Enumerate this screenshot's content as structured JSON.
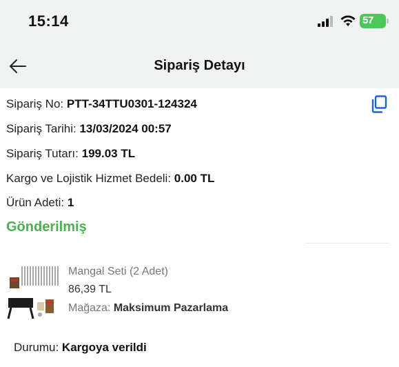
{
  "status_bar": {
    "time": "15:14",
    "battery_level": "57",
    "battery_color": "#4cc85a",
    "icons": [
      "signal-icon",
      "wifi-icon",
      "battery-icon"
    ]
  },
  "header": {
    "title": "Sipariş Detayı",
    "back_icon": "arrow-left-icon"
  },
  "order": {
    "number_label": "Sipariş No:",
    "number_value": "PTT-34TTU0301-124324",
    "date_label": "Sipariş Tarihi:",
    "date_value": "13/03/2024 00:57",
    "amount_label": "Sipariş Tutarı:",
    "amount_value": "199.03 TL",
    "shipping_label": "Kargo ve Lojistik Hizmet Bedeli:",
    "shipping_value": "0.00 TL",
    "qty_label": "Ürün Adeti:",
    "qty_value": "1",
    "status": "Gönderilmiş",
    "status_color": "#4caf50",
    "copy_icon": "copy-icon"
  },
  "product": {
    "name": "Mangal Seti (2 Adet)",
    "price": "86,39 TL",
    "store_label": "Mağaza:",
    "store_value": "Maksimum Pazarlama",
    "image_icon": "barbecue-set-image"
  },
  "shipment": {
    "label": "Durumu:",
    "value": "Kargoya verildi"
  }
}
